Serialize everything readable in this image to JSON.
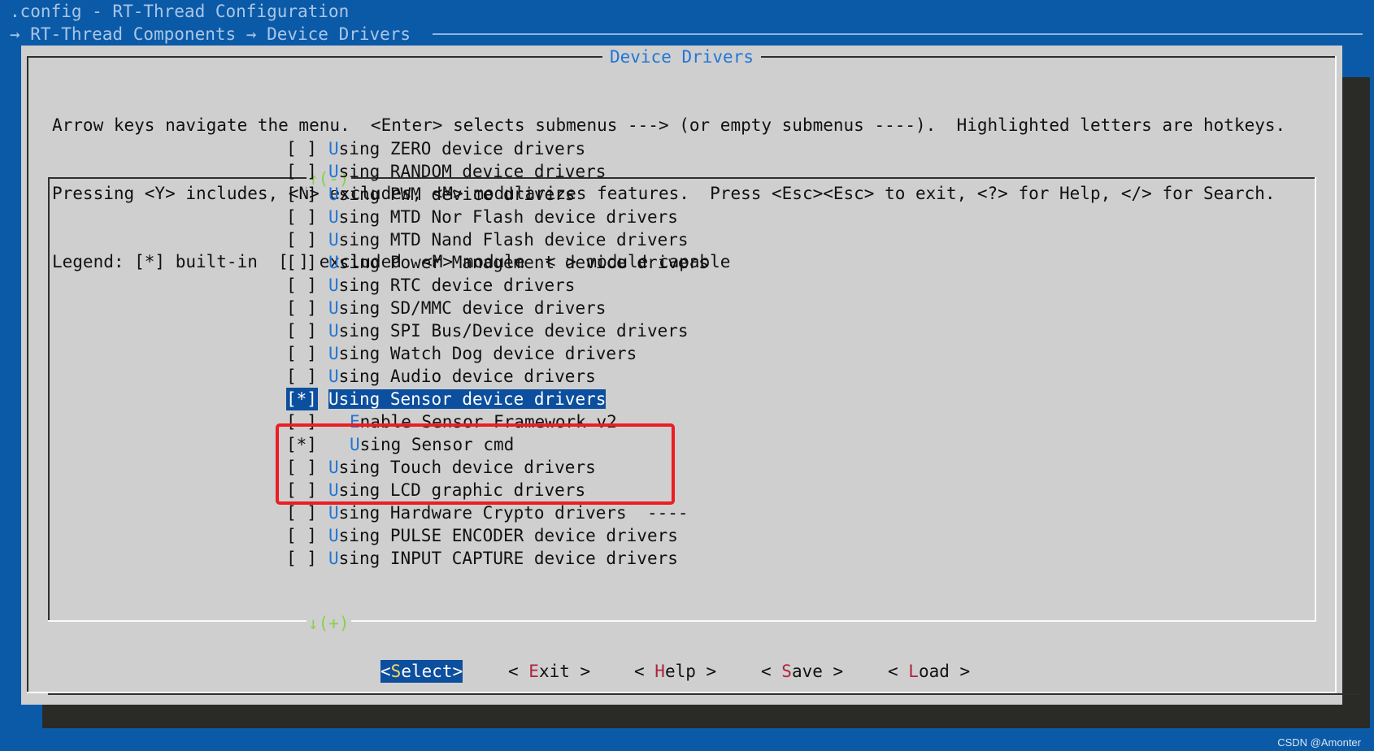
{
  "header": {
    "title": ".config - RT-Thread Configuration",
    "breadcrumb": "→ RT-Thread Components → Device Drivers"
  },
  "dialog": {
    "title": "Device Drivers",
    "help_lines": [
      "Arrow keys navigate the menu.  <Enter> selects submenus ---> (or empty submenus ----).  Highlighted letters are hotkeys.",
      "Pressing <Y> includes, <N> excludes, <M> modularizes features.  Press <Esc><Esc> to exit, <?> for Help, </> for Search.",
      "Legend: [*] built-in  [ ] excluded  <M> module  < > module capable"
    ],
    "scroll_up": "↑(-)",
    "scroll_down": "↓(+)"
  },
  "menu": {
    "items": [
      {
        "box": "[ ]",
        "hot": "U",
        "rest": "sing ZERO device drivers"
      },
      {
        "box": "[ ]",
        "hot": "U",
        "rest": "sing RANDOM device drivers"
      },
      {
        "box": "[ ]",
        "hot": "U",
        "rest": "sing PWM device drivers"
      },
      {
        "box": "[ ]",
        "hot": "U",
        "rest": "sing MTD Nor Flash device drivers"
      },
      {
        "box": "[ ]",
        "hot": "U",
        "rest": "sing MTD Nand Flash device drivers"
      },
      {
        "box": "[ ]",
        "hot": "U",
        "rest": "sing Power Management device drivers"
      },
      {
        "box": "[ ]",
        "hot": "U",
        "rest": "sing RTC device drivers"
      },
      {
        "box": "[ ]",
        "hot": "U",
        "rest": "sing SD/MMC device drivers"
      },
      {
        "box": "[ ]",
        "hot": "U",
        "rest": "sing SPI Bus/Device device drivers"
      },
      {
        "box": "[ ]",
        "hot": "U",
        "rest": "sing Watch Dog device drivers"
      },
      {
        "box": "[ ]",
        "hot": "U",
        "rest": "sing Audio device drivers"
      },
      {
        "box": "[*]",
        "hot": "U",
        "rest": "sing Sensor device drivers"
      },
      {
        "box": "[ ]",
        "hot": "E",
        "rest": "nable Sensor Framework v2"
      },
      {
        "box": "[*]",
        "hot": "U",
        "rest": "sing Sensor cmd"
      },
      {
        "box": "[ ]",
        "hot": "U",
        "rest": "sing Touch device drivers"
      },
      {
        "box": "[ ]",
        "hot": "U",
        "rest": "sing LCD graphic drivers"
      },
      {
        "box": "[ ]",
        "hot": "U",
        "rest": "sing Hardware Crypto drivers  ----"
      },
      {
        "box": "[ ]",
        "hot": "U",
        "rest": "sing PULSE ENCODER device drivers"
      },
      {
        "box": "[ ]",
        "hot": "U",
        "rest": "sing INPUT CAPTURE device drivers"
      }
    ]
  },
  "buttons": {
    "select": {
      "pre": "<",
      "hot": "S",
      "post": "elect>"
    },
    "exit": {
      "pre": "< ",
      "hot": "E",
      "post": "xit >"
    },
    "help": {
      "pre": "< ",
      "hot": "H",
      "post": "elp >"
    },
    "save": {
      "pre": "< ",
      "hot": "S",
      "post": "ave >"
    },
    "load": {
      "pre": "< ",
      "hot": "L",
      "post": "oad >"
    }
  },
  "watermark": "CSDN @Amonter",
  "colors": {
    "background": "#0b5aa8",
    "dialog": "#cfcfcf",
    "selection": "#0b4f9e",
    "hotkey": "#2276d6",
    "button_hotkey": "#b0223e",
    "annotation": "#ec1d23"
  }
}
